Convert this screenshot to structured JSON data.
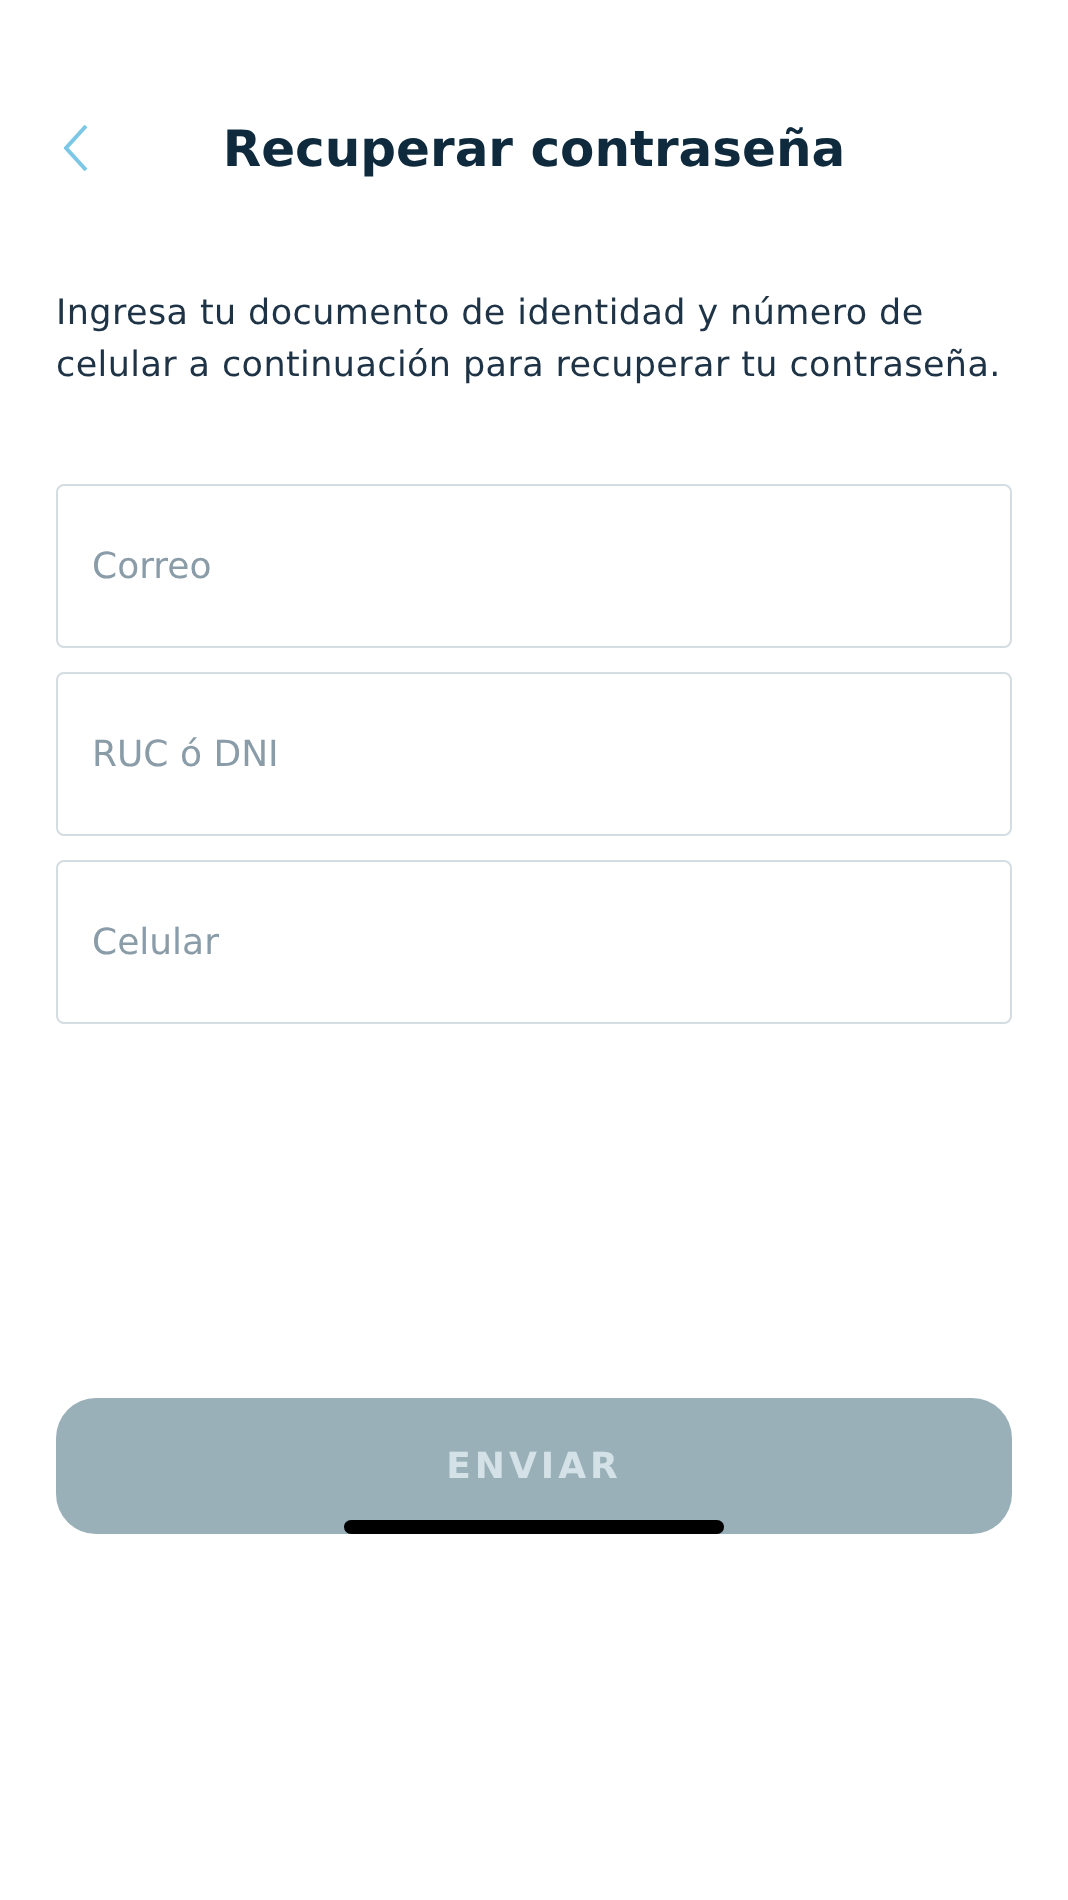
{
  "header": {
    "title": "Recuperar contraseña"
  },
  "instructions": "Ingresa tu documento de identidad y número de celular a continuación para recuperar tu contraseña.",
  "fields": [
    {
      "placeholder": "Correo"
    },
    {
      "placeholder": "RUC ó DNI"
    },
    {
      "placeholder": "Celular"
    }
  ],
  "submit": {
    "label": "ENVIAR",
    "disabled": true
  }
}
